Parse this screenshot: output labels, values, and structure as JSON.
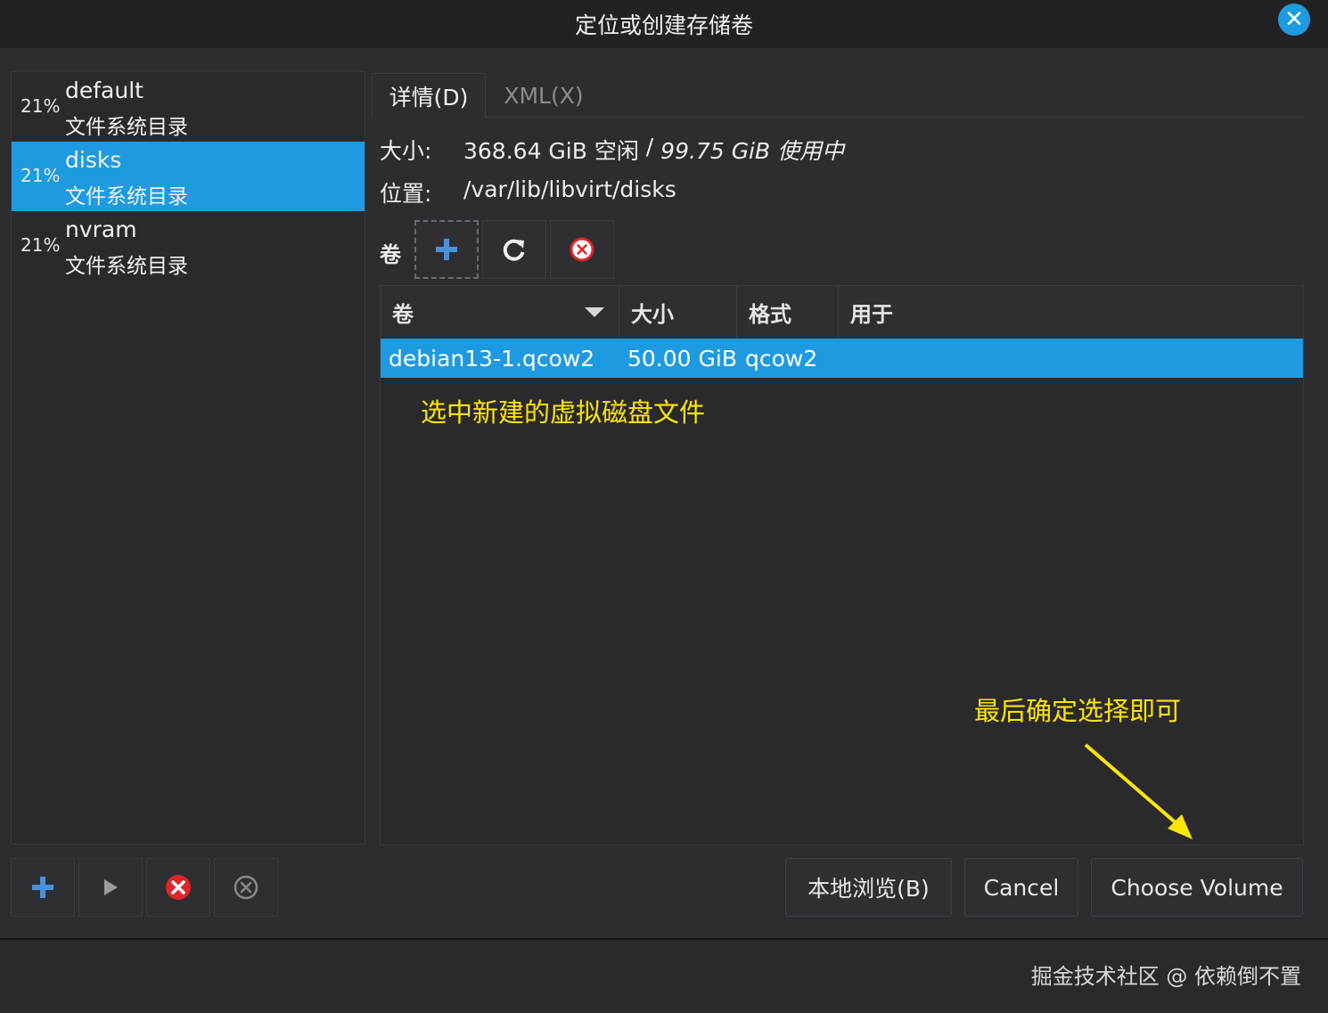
{
  "window": {
    "title": "定位或创建存储卷"
  },
  "colors": {
    "accent": "#1e9be0",
    "annotation": "#ffe600",
    "danger": "#e0242a"
  },
  "pools": [
    {
      "percent": "21%",
      "name": "default",
      "type": "文件系统目录",
      "selected": false
    },
    {
      "percent": "21%",
      "name": "disks",
      "type": "文件系统目录",
      "selected": true
    },
    {
      "percent": "21%",
      "name": "nvram",
      "type": "文件系统目录",
      "selected": false
    }
  ],
  "tabs": {
    "details": "详情(D)",
    "xml": "XML(X)"
  },
  "details": {
    "size_label": "大小:",
    "size_free": "368.64 GiB 空闲",
    "size_sep": " / ",
    "size_used": "99.75 GiB 使用中",
    "location_label": "位置:",
    "location_value": "/var/lib/libvirt/disks",
    "volumes_label": "卷"
  },
  "table": {
    "headers": {
      "volume": "卷",
      "size": "大小",
      "format": "格式",
      "used_by": "用于"
    },
    "rows": [
      {
        "volume": "debian13-1.qcow2",
        "size": "50.00 GiB",
        "format": "qcow2",
        "used_by": ""
      }
    ]
  },
  "annotations": {
    "select_file": "选中新建的虚拟磁盘文件",
    "confirm": "最后确定选择即可"
  },
  "buttons": {
    "browse_local": "本地浏览(B)",
    "cancel": "Cancel",
    "choose_volume": "Choose Volume"
  },
  "watermark": "掘金技术社区 @ 依赖倒不置"
}
